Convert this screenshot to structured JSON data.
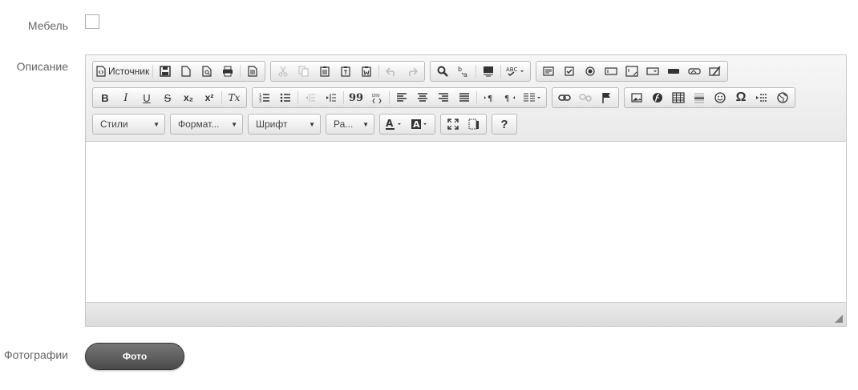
{
  "form": {
    "furniture_label": "Мебель",
    "description_label": "Описание",
    "photos_label": "Фотографии",
    "photo_button_label": "Фото"
  },
  "editor": {
    "source_label": "Источник",
    "styles_label": "Стили",
    "format_label": "Формат...",
    "font_label": "Шрифт",
    "size_label": "Ра...",
    "help_label": "?",
    "omega_label": "Ω",
    "bold_label": "B",
    "italic_label": "I",
    "underline_label": "U",
    "strike_label": "S",
    "sub_label": "x₂",
    "sup_label": "x²",
    "removeformat_label": "Tx",
    "blockquote_label": "99"
  }
}
